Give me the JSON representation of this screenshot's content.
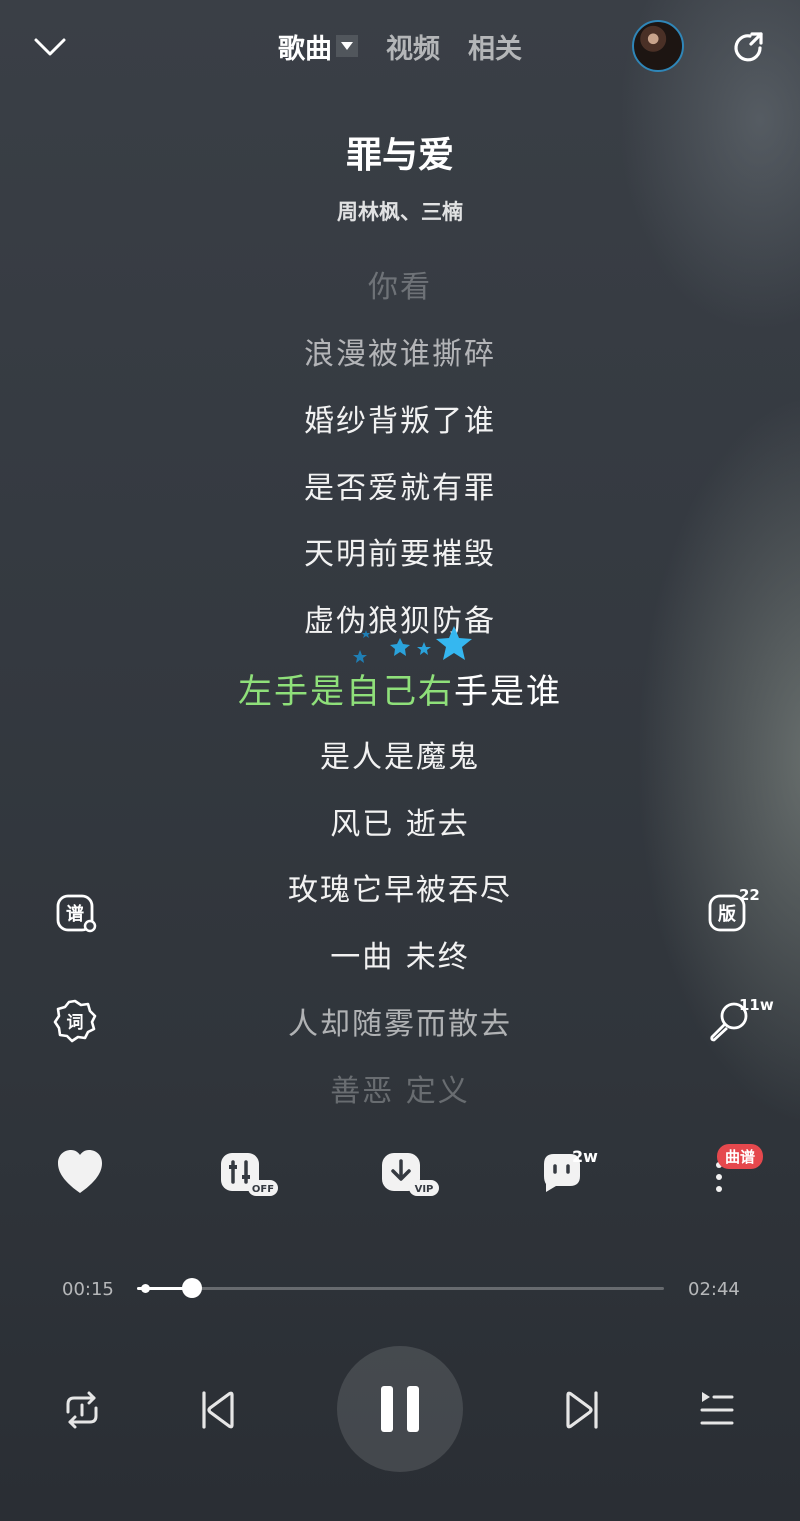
{
  "header": {
    "tabs": [
      {
        "label": "歌曲",
        "active": true
      },
      {
        "label": "视频",
        "active": false
      },
      {
        "label": "相关",
        "active": false
      }
    ]
  },
  "song": {
    "title": "罪与爱",
    "artist": "周林枫、三楠"
  },
  "lyrics": {
    "before": [
      "你看",
      "浪漫被谁撕碎",
      "婚纱背叛了谁",
      "是否爱就有罪",
      "天明前要摧毁",
      "虚伪狼狈防备"
    ],
    "current_sung": "左手是自己右",
    "current_rest": "手是谁",
    "after": [
      "是人是魔鬼",
      "风已 逝去",
      "玫瑰它早被吞尽",
      "一曲 未终",
      "人却随雾而散去",
      "善恶 定义"
    ]
  },
  "side": {
    "left_top_icon_text": "谱",
    "left_bottom_icon_text": "词",
    "right_top_icon_text": "版",
    "right_top_count": "22",
    "right_bottom_count": "11w"
  },
  "actions": {
    "effect_tag": "OFF",
    "download_tag": "VIP",
    "comment_count": "2w",
    "more_badge": "曲谱"
  },
  "progress": {
    "current_time": "00:15",
    "total_time": "02:44",
    "fraction": 0.105
  },
  "colors": {
    "highlight": "#8fe07a",
    "badge": "#e5484d",
    "avatar_ring": "#2f86b8"
  }
}
